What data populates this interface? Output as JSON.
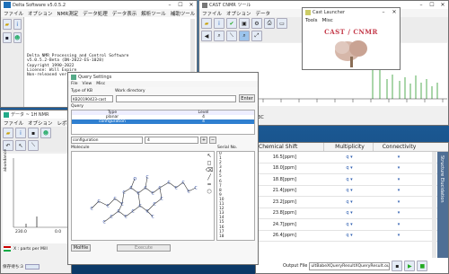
{
  "delta": {
    "title": "Delta Software v5.0.5.2",
    "menu": [
      "ファイル",
      "オプション",
      "NMR測定",
      "データ処理",
      "データ表示",
      "解析ツール",
      "補助ツール"
    ],
    "log": [
      "Delta NMR Processing and Control Software",
      "v5.0.5.2-Beta (DN-2022-ES-1028)",
      "Copyright 1990-2022",
      "License: Will Expire",
      "Non-released version"
    ]
  },
  "tracker": {
    "title": "データ ~ 1H NMR",
    "menu": [
      "ファイル",
      "オプション",
      "レポ"
    ],
    "axis_ticks": [
      "230.0",
      "0.0"
    ],
    "ylabel": "abundance",
    "xlabel": "X : parts per Mill",
    "status": "保存待ち:3"
  },
  "castcmnr": {
    "title": "CAST CNMR ツール",
    "menu": [
      "ファイル",
      "オプション",
      "データ"
    ],
    "scale_label": "13C"
  },
  "launcher": {
    "title": "Cast Launcher",
    "menu": [
      "Tools",
      "Misc"
    ],
    "logo_text": "CAST / CNMR"
  },
  "query": {
    "title": "Query Settings",
    "menu": [
      "File",
      "View",
      "Misc"
    ],
    "type_label": "Type of KB",
    "type_value": "KB20190423-cast",
    "workdir_label": "Work directory",
    "enter_label": "Enter",
    "query_label": "Query",
    "col_type": "Type",
    "col_level": "Level",
    "rows": [
      {
        "type": "planar",
        "level": "4"
      },
      {
        "type": "configuration",
        "level": "4"
      }
    ],
    "conf_value": "configuration",
    "level_value": "4",
    "molecule_label": "Molecule",
    "serial_label": "Serial No.",
    "serial_numbers": [
      "0",
      "1",
      "2",
      "3",
      "4",
      "5",
      "6",
      "7",
      "8",
      "9",
      "10",
      "11",
      "12",
      "13",
      "14",
      "15",
      "16",
      "17",
      "18"
    ],
    "molfile_label": "Molfile",
    "execute_label": "Execute",
    "atoms": [
      "C",
      "C",
      "C",
      "C",
      "C",
      "C",
      "C",
      "C",
      "C",
      "C",
      "C",
      "C",
      "C",
      "C",
      "C",
      "C",
      "C",
      "C",
      "C",
      "C",
      "C",
      "C",
      "C",
      "C",
      "C",
      "O",
      "C",
      "C"
    ]
  },
  "shifts": {
    "col_shift": "Chemical Shift",
    "col_mult": "Multiplicity",
    "col_conn": "Connectivity",
    "rows": [
      {
        "shift": "16.5[ppm]",
        "mult": "q"
      },
      {
        "shift": "18.0[ppm]",
        "mult": "q"
      },
      {
        "shift": "18.8[ppm]",
        "mult": "q"
      },
      {
        "shift": "21.4[ppm]",
        "mult": "q"
      },
      {
        "shift": "23.2[ppm]",
        "mult": "q"
      },
      {
        "shift": "23.8[ppm]",
        "mult": "q"
      },
      {
        "shift": "24.7[ppm]",
        "mult": "q"
      },
      {
        "shift": "26.4[ppm]",
        "mult": "q"
      }
    ],
    "output_label": "Output File",
    "output_value": "ultBabeXQueryResultXQueryResult.out",
    "side_tab": "Structure Elucidation"
  }
}
